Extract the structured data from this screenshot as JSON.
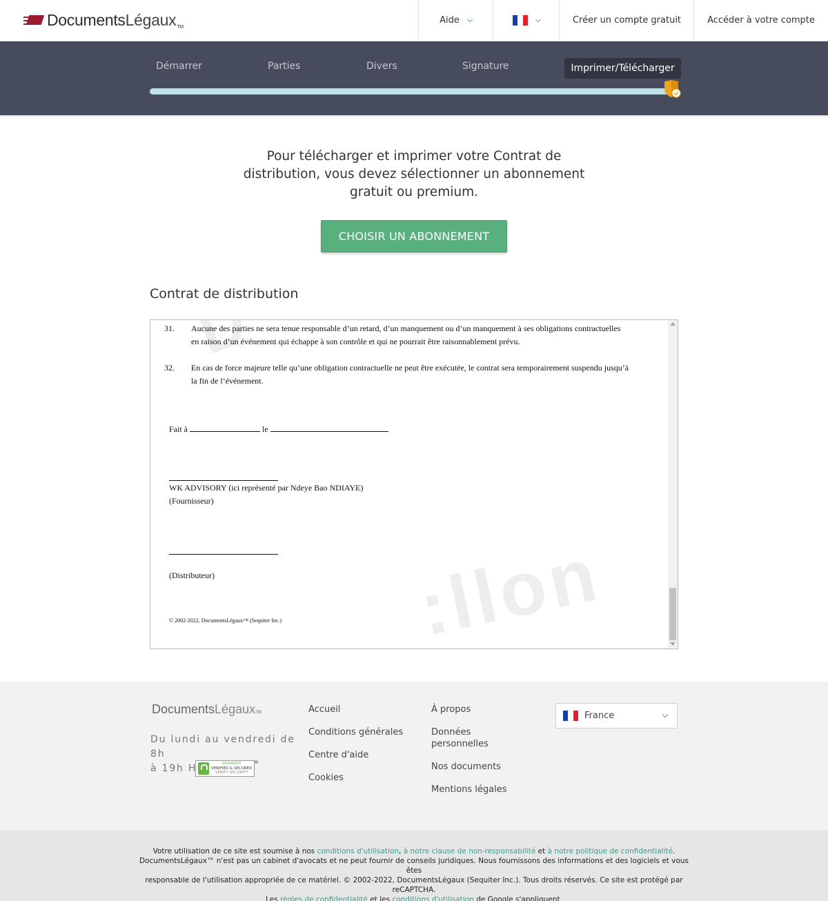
{
  "header": {
    "logo_main": "Documents",
    "logo_light": "Légaux",
    "logo_tm": "TM",
    "help_label": "Aide",
    "language_flag": "fr-flag",
    "create_account": "Créer un compte gratuit",
    "login": "Accéder à votre compte"
  },
  "steps": {
    "items": [
      "Démarrer",
      "Parties",
      "Divers",
      "Signature",
      "Imprimer/Télécharger"
    ],
    "active_index": 4,
    "progress_fraction": 1.0
  },
  "main": {
    "intro_line1": "Pour télécharger et imprimer votre Contrat de",
    "intro_line2": "distribution, vous devez sélectionner un abonnement",
    "intro_line3": "gratuit ou premium.",
    "cta_label": "CHOISIR UN ABONNEMENT",
    "doc_title": "Contrat de distribution"
  },
  "document": {
    "clauses": [
      {
        "num": "31.",
        "line1": "Aucune des parties ne sera tenue responsable d’un retard, d’un manquement ou d’un manquement à ses obligations contractuelles",
        "line2": "en raison d’un événement qui échappe à son contrôle et qui ne pourrait être raisonnablement prévu."
      },
      {
        "num": "32.",
        "line1": "En cas de force majeure telle qu’une obligation contractuelle ne peut être exécutée, le contrat sera temporairement suspendu jusqu’à",
        "line2": "la fin de l’événement."
      }
    ],
    "fait_a": "Fait à",
    "le": "le",
    "supplier_name": "WK ADVISORY (ici représenté par Ndeye Bao NDIAYE)",
    "supplier_role": "(Fournisseur)",
    "distributor_role": "(Distributeur)",
    "copyright": "© 2002-2022, DocumentsLégaux™ (Sequiter Inc.)"
  },
  "footer": {
    "logo_main": "Documents",
    "logo_light": "Légaux",
    "logo_tm": "TM",
    "hours_line1": "Du lundi au vendredi de 8h",
    "hours_line2": "à 19h HE",
    "badge_line1": "GODADDY",
    "badge_line2": "VERIFIED & SECURED",
    "badge_line3": "VERIFY SECURITY",
    "col1": [
      "Accueil",
      "Conditions générales",
      "Centre d'aide",
      "Cookies"
    ],
    "col2_item1": "À propos",
    "col2_item2_line1": "Données",
    "col2_item2_line2": "personnelles",
    "col2_item3": "Nos documents",
    "col2_item4": "Mentions légales",
    "country": "France"
  },
  "legal": {
    "l1_a": "Votre utilisation de ce site est soumise à nos ",
    "l1_link1": "conditions d'utilisation",
    "l1_b": ", ",
    "l1_link2": "à notre clause de non-responsabilité",
    "l1_c": " et ",
    "l1_link3": "à notre politique de confidentialité",
    "l1_d": ".",
    "l2": "DocumentsLégaux™ n'est pas un cabinet d'avocats et ne peut fournir de conseils juridiques. Nous fournissons des informations et des logiciels et vous êtes",
    "l3": "responsable de l'utilisation appropriée de ce matériel. © 2002-2022, DocumentsLégaux (Sequiter Inc.). Tous droits réservés. Ce site est protégé par reCAPTCHA.",
    "l4_a": "Les ",
    "l4_link1": "règles de confidentialité",
    "l4_b": " et les ",
    "l4_link2": "conditions d'utilisation",
    "l4_c": " de Google s'appliquent."
  },
  "colors": {
    "band": "#474c5c",
    "progress": "#bfe0e6",
    "cta": "#5aaf7e",
    "link": "#3a9e8f",
    "brand": "#9b1b30"
  }
}
